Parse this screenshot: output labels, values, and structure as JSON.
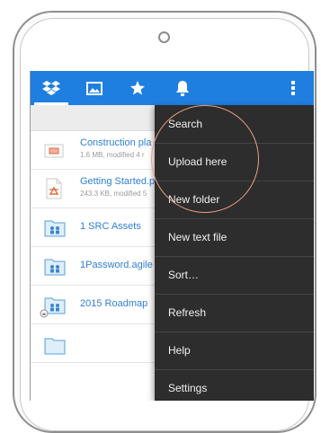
{
  "toolbar": {
    "icons": [
      "dropbox-icon",
      "photos-icon",
      "favorites-star-icon",
      "notifications-bell-icon",
      "overflow-menu-icon"
    ],
    "bar_color": "#1f7fe0"
  },
  "files": [
    {
      "name": "Construction pla",
      "meta": "1.6 MB, modified 4 r",
      "kind": "presentation"
    },
    {
      "name": "Getting Started.p",
      "meta": "243.3 KB, modified 5",
      "kind": "pdf"
    },
    {
      "name": "1 SRC Assets",
      "meta": "",
      "kind": "shared-folder"
    },
    {
      "name": "1Password.agile",
      "meta": "",
      "kind": "shared-folder"
    },
    {
      "name": "2015 Roadmap",
      "meta": "",
      "kind": "shared-folder-locked"
    },
    {
      "name": "",
      "meta": "",
      "kind": "folder"
    }
  ],
  "menu": {
    "items": [
      {
        "label": "Search"
      },
      {
        "label": "Upload here"
      },
      {
        "label": "New folder"
      },
      {
        "label": "New text file"
      },
      {
        "label": "Sort…"
      },
      {
        "label": "Refresh"
      },
      {
        "label": "Help"
      },
      {
        "label": "Settings"
      }
    ]
  }
}
